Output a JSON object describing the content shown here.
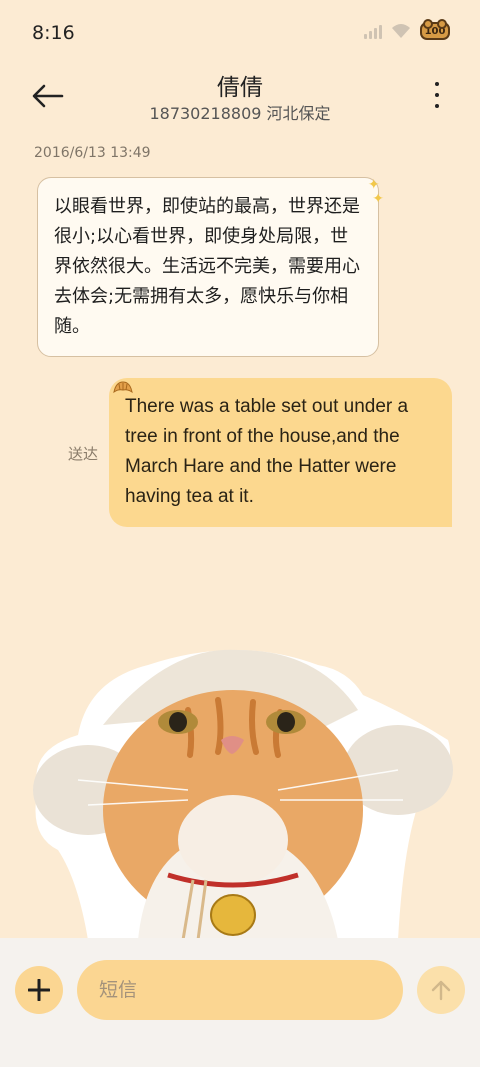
{
  "status_bar": {
    "time": "8:16",
    "battery_label": "100",
    "signal_icon": "signal-bars-icon",
    "wifi_icon": "wifi-icon"
  },
  "header": {
    "contact_name": "倩倩",
    "contact_subtitle": "18730218809 河北保定",
    "back_icon": "arrow-left-icon",
    "more_icon": "more-vertical-icon"
  },
  "conversation": {
    "timestamp": "2016/6/13 13:49",
    "incoming": {
      "text": "以眼看世界，即使站的最高，世界还是很小;以心看世界，即使身处局限，世界依然很大。生活远不完美，需要用心去体会;无需拥有太多，愿快乐与你相随。"
    },
    "outgoing": {
      "text": "There was a table set out under a tree in front of the house,and the March Hare and the Hatter were having tea at it.",
      "status": "送达"
    },
    "sticker": "cat-sticker"
  },
  "composer": {
    "placeholder": "短信",
    "add_icon": "plus-icon",
    "send_icon": "arrow-up-icon"
  },
  "colors": {
    "background": "#fcebd3",
    "bubble_out": "#fcd88f",
    "bubble_in": "#fffaf1",
    "composer_accent": "#fbd692"
  }
}
